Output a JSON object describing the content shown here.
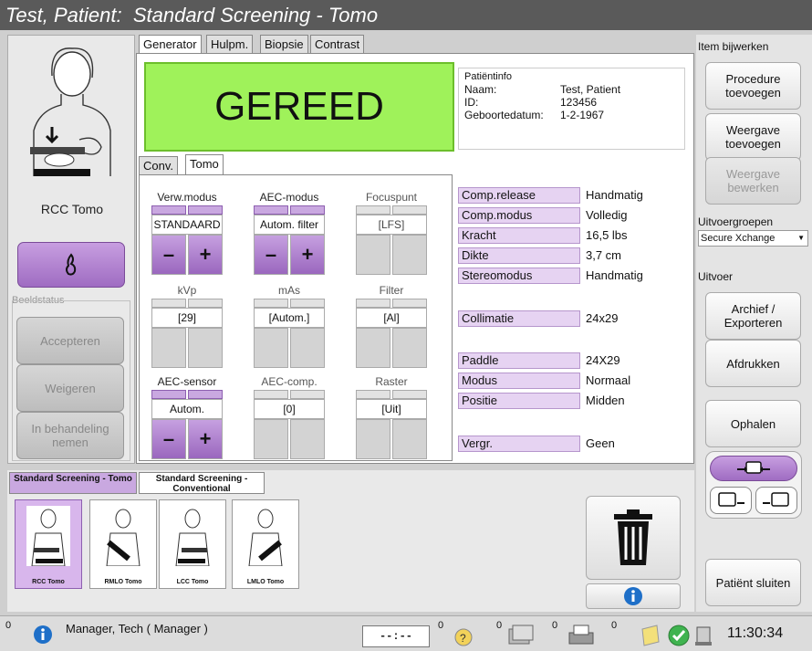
{
  "title": "Test, Patient:  Standard Screening - Tomo",
  "left": {
    "view_label": "RCC Tomo",
    "beeldstatus": "Beeldstatus",
    "accept": "Accepteren",
    "reject": "Weigeren",
    "pending": "In behandeling nemen"
  },
  "tabs": {
    "generator": "Generator",
    "hulpm": "Hulpm.",
    "biopsie": "Biopsie",
    "contrast": "Contrast",
    "conv": "Conv.",
    "tomo": "Tomo"
  },
  "status_ready": "GEREED",
  "patient": {
    "header": "Patiëntinfo",
    "name_k": "Naam:",
    "name_v": "Test, Patient",
    "id_k": "ID:",
    "id_v": "123456",
    "dob_k": "Geboortedatum:",
    "dob_v": "1-2-1967"
  },
  "controls": {
    "verw_label": "Verw.modus",
    "verw_val": "STANDAARD",
    "aec_modus_label": "AEC-modus",
    "aec_modus_val": "Autom. filter",
    "focus_label": "Focuspunt",
    "focus_val": "[LFS]",
    "kvp_label": "kVp",
    "kvp_val": "[29]",
    "mas_label": "mAs",
    "mas_val": "[Autom.]",
    "filter_label": "Filter",
    "filter_val": "[Al]",
    "aecs_label": "AEC-sensor",
    "aecs_val": "Autom.",
    "aecc_label": "AEC-comp.",
    "aecc_val": "[0]",
    "raster_label": "Raster",
    "raster_val": "[Uit]",
    "minus": "–",
    "plus": "+"
  },
  "params": [
    {
      "k": "Comp.release",
      "v": "Handmatig"
    },
    {
      "k": "Comp.modus",
      "v": "Volledig"
    },
    {
      "k": "Kracht",
      "v": "16,5 lbs"
    },
    {
      "k": "Dikte",
      "v": "3,7 cm"
    },
    {
      "k": "Stereomodus",
      "v": "Handmatig"
    },
    {
      "k": "Collimatie",
      "v": "24x29"
    },
    {
      "k": "Paddle",
      "v": "24X29"
    },
    {
      "k": "Modus",
      "v": "Normaal"
    },
    {
      "k": "Positie",
      "v": "Midden"
    },
    {
      "k": "Vergr.",
      "v": "Geen"
    }
  ],
  "right": {
    "item_bijwerken": "Item bijwerken",
    "procedure": "Procedure toevoegen",
    "weergave_toev": "Weergave toevoegen",
    "weergave_bew": "Weergave bewerken",
    "uitvoergroepen": "Uitvoergroepen",
    "select_val": "Secure Xchange",
    "uitvoer": "Uitvoer",
    "archief": "Archief / Exporteren",
    "afdrukken": "Afdrukken",
    "ophalen": "Ophalen",
    "sluiten": "Patiënt sluiten"
  },
  "procedure_tabs": {
    "t1": "Standard Screening - Tomo",
    "t2": "Standard Screening - Conventional"
  },
  "thumbs": [
    "RCC Tomo",
    "RMLO Tomo",
    "LCC Tomo",
    "LMLO Tomo"
  ],
  "statusbar": {
    "count0": "0",
    "user": "Manager, Tech ( Manager )",
    "timer": "--:--",
    "c1": "0",
    "c2": "0",
    "c3": "0",
    "c4": "0",
    "clock": "11:30:34"
  }
}
